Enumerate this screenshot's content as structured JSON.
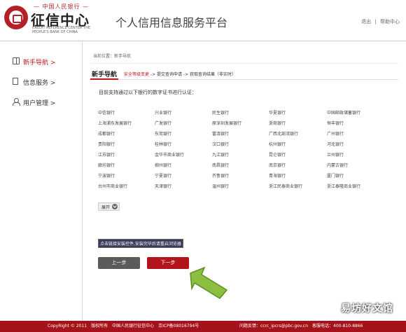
{
  "header": {
    "logo_top": "— 中国人民银行 —",
    "logo_main": "征信中心",
    "logo_en": "CREDIT REFERENCE CENTER THE PEOPLE'S BANK OF CHINA",
    "platform_title": "个人信用信息服务平台",
    "links": [
      "退出",
      "|",
      "帮助中心"
    ]
  },
  "sidebar": {
    "items": [
      {
        "label": "新手导航 >",
        "icon": "book-icon"
      },
      {
        "label": "信息服务 >",
        "icon": "document-icon"
      },
      {
        "label": "用户管理 >",
        "icon": "user-icon"
      }
    ]
  },
  "main": {
    "breadcrumb": "当前位置：新手导航",
    "nav_title": "新手导航",
    "steps": {
      "current": "安全等级变更",
      "rest": " -> 提交查询申请 -> 获取查询结果（非实时）"
    },
    "intro": "目前支持通过以下银行的数字证书进行认证：",
    "banks": [
      [
        "中信银行",
        "兴业银行",
        "民生银行",
        "华夏银行",
        "中国邮政储蓄银行"
      ],
      [
        "上海浦东发展银行",
        "广发银行",
        "原深圳发展银行",
        "浙商银行",
        "恒丰银行"
      ],
      [
        "成都银行",
        "东莞银行",
        "富滇银行",
        "广西北部湾银行",
        "广州银行"
      ],
      [
        "贵阳银行",
        "桂林银行",
        "汉口银行",
        "杭州银行",
        "河北银行"
      ],
      [
        "江苏银行",
        "金华市商业银行",
        "九江银行",
        "昆仑银行",
        "兰州银行"
      ],
      [
        "廊坊银行",
        "柳州银行",
        "南昌银行",
        "南京银行",
        "内蒙古银行"
      ],
      [
        "宁波银行",
        "宁夏银行",
        "齐鲁银行",
        "青海银行",
        "厦门银行"
      ],
      [
        "台州市商业银行",
        "天津银行",
        "温州银行",
        "浙江民泰商业银行",
        "浙江泰隆商业银行"
      ]
    ],
    "expand_label": "展开",
    "install_link": "点击链接安装控件,安装完毕后请重启浏览器",
    "prev_label": "上一步",
    "next_label": "下一步"
  },
  "watermark": "易坊好文馆",
  "footer": {
    "copyright": "CopyRight © 2011　版权所有　中国人民银行征信中心　京ICP备08016794号",
    "feedback": "问题反馈：ccrc_ipcrs@pbc.gov.cn　客服电话：400-810-8866"
  },
  "colors": {
    "accent": "#c0161d",
    "footer": "#a61219",
    "arrow": "#8cbf3f"
  }
}
